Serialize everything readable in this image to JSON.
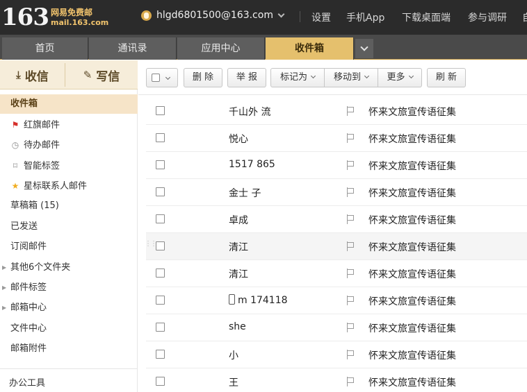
{
  "brand": {
    "number": "163",
    "name_cn": "网易免费邮",
    "domain": "mail.163.com"
  },
  "account": {
    "email": "hlgd6801500@163.com"
  },
  "top_links": [
    "设置",
    "手机App",
    "下载桌面端",
    "参与调研",
    "自"
  ],
  "tabs": [
    {
      "label": "首页",
      "active": false
    },
    {
      "label": "通讯录",
      "active": false
    },
    {
      "label": "应用中心",
      "active": false
    },
    {
      "label": "收件箱",
      "active": true
    }
  ],
  "sidebar": {
    "receive_label": "收信",
    "compose_label": "写信",
    "folders": [
      {
        "label": "收件箱",
        "icon": "",
        "active": true
      },
      {
        "label": "红旗邮件",
        "icon": "red-flag-icon"
      },
      {
        "label": "待办邮件",
        "icon": "clock-icon"
      },
      {
        "label": "智能标签",
        "icon": "tag-icon"
      },
      {
        "label": "星标联系人邮件",
        "icon": "star-icon"
      },
      {
        "label": "草稿箱 (15)",
        "icon": ""
      },
      {
        "label": "已发送",
        "icon": ""
      },
      {
        "label": "订阅邮件",
        "icon": ""
      },
      {
        "label": "其他6个文件夹",
        "icon": "",
        "expandable": true
      },
      {
        "label": "邮件标签",
        "icon": "",
        "expandable": true
      },
      {
        "label": "邮箱中心",
        "icon": "",
        "expandable": true
      },
      {
        "label": "文件中心",
        "icon": ""
      },
      {
        "label": "邮箱附件",
        "icon": ""
      }
    ],
    "office_tools": "办公工具"
  },
  "toolbar": {
    "delete": "删 除",
    "report": "举 报",
    "mark_as": "标记为",
    "move_to": "移动到",
    "more": "更多",
    "refresh": "刷 新"
  },
  "mails": [
    {
      "sender": "千山外  流",
      "subject": "怀来文旅宣传语征集"
    },
    {
      "sender": "悦心",
      "subject": "怀来文旅宣传语征集"
    },
    {
      "sender": "1517     865",
      "subject": "怀来文旅宣传语征集"
    },
    {
      "sender": "金士    子",
      "subject": "怀来文旅宣传语征集"
    },
    {
      "sender": "卓成",
      "subject": "怀来文旅宣传语征集"
    },
    {
      "sender": "清江",
      "subject": "怀来文旅宣传语征集"
    },
    {
      "sender": "清江",
      "subject": "怀来文旅宣传语征集"
    },
    {
      "sender": "m      174118",
      "subject": "怀来文旅宣传语征集",
      "phone": true
    },
    {
      "sender": "she",
      "subject": "怀来文旅宣传语征集"
    },
    {
      "sender": "小",
      "subject": "怀来文旅宣传语征集"
    },
    {
      "sender": "王",
      "subject": "怀来文旅宣传语征集"
    }
  ],
  "colors": {
    "header_bg": "#2b2b2b",
    "brand_gold": "#f2c46d",
    "active_tab": "#e5c06d",
    "sidebar_active": "#f6e4c8"
  }
}
